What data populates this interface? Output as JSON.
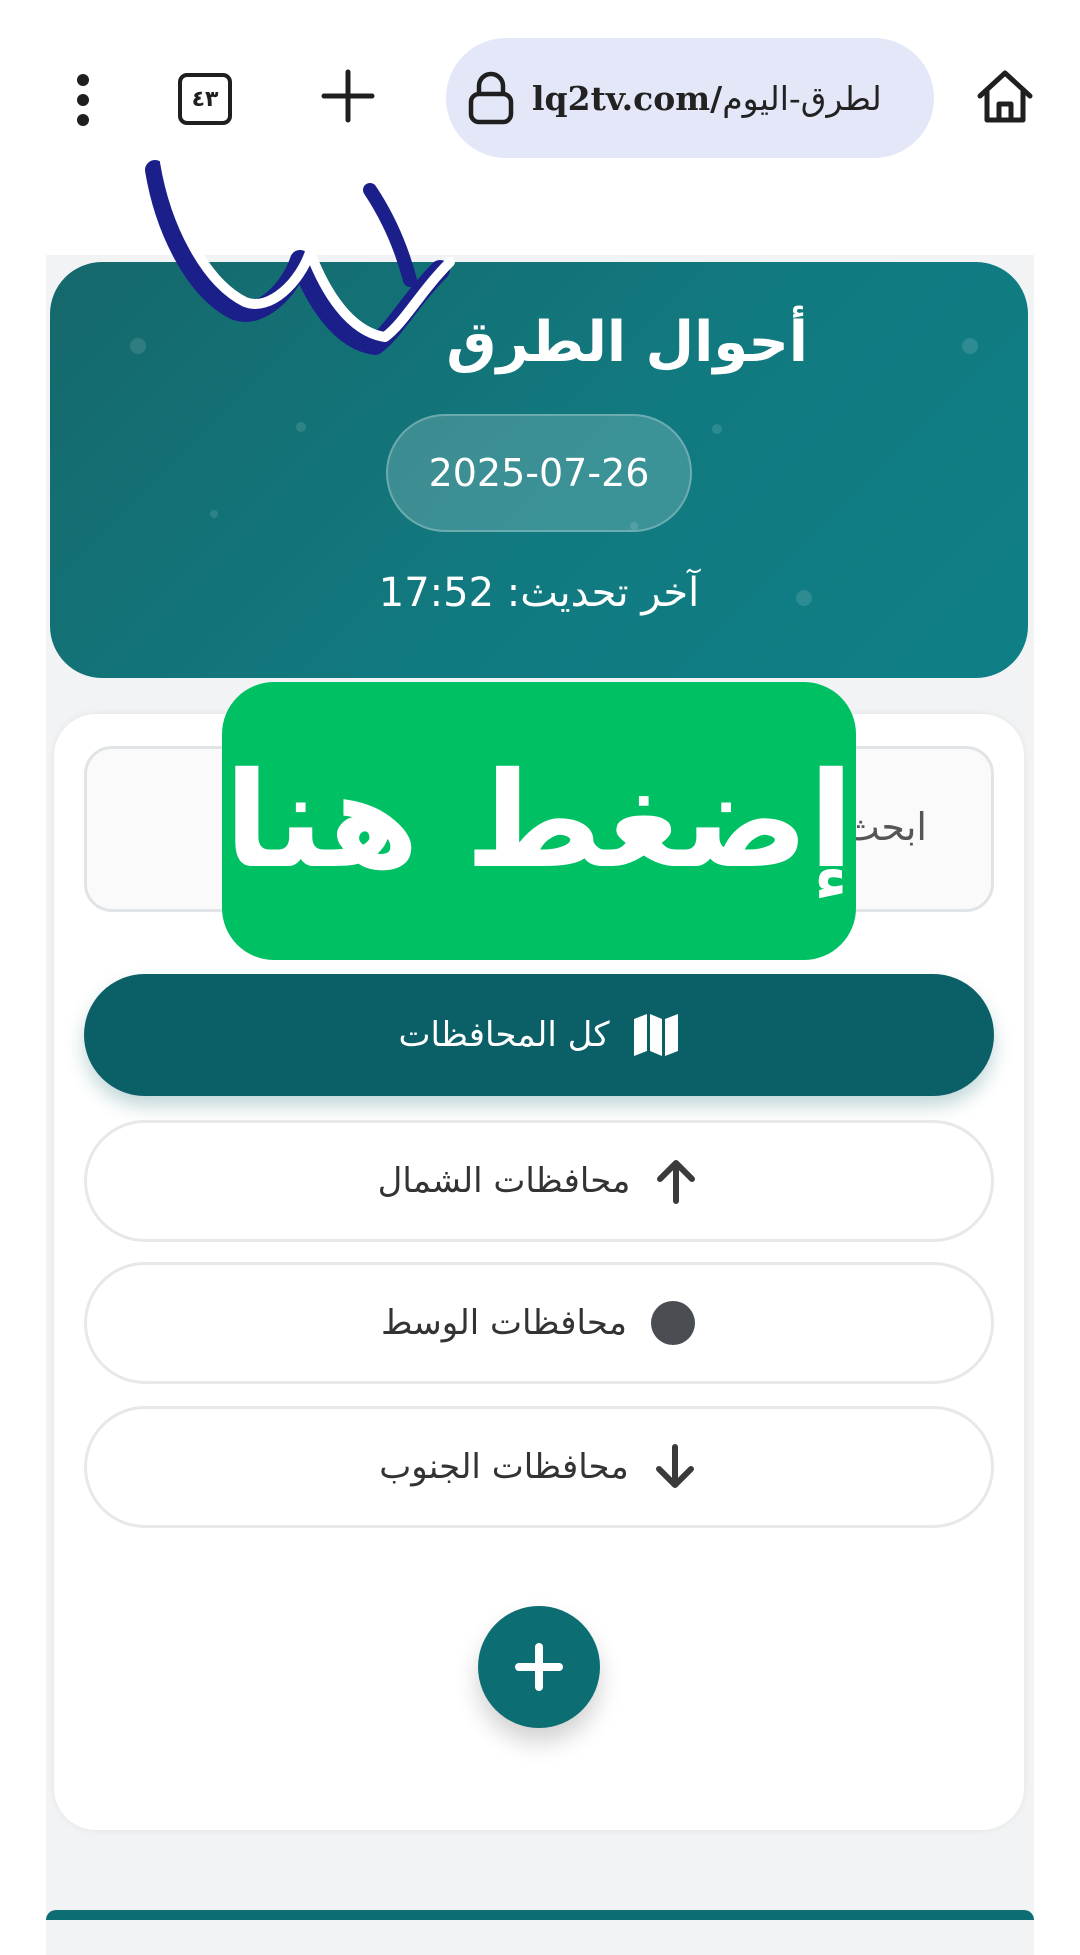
{
  "browser": {
    "tab_count": "٤٣",
    "url_domain": "lq2tv.com/",
    "url_path": "لطرق-اليوم"
  },
  "header": {
    "title": "أحوال الطرق",
    "date": "2025-07-26",
    "last_update": "آخر تحديث: 17:52"
  },
  "search": {
    "placeholder": "ابحث"
  },
  "regions": [
    {
      "label": "كل المحافظات",
      "icon": "map-icon",
      "active": true
    },
    {
      "label": "محافظات الشمال",
      "icon": "arrow-up-icon",
      "active": false
    },
    {
      "label": "محافظات الوسط",
      "icon": "circle-icon",
      "active": false
    },
    {
      "label": "محافظات الجنوب",
      "icon": "arrow-down-icon",
      "active": false
    }
  ],
  "overlay": {
    "promo_label": "إضغط هنا"
  },
  "colors": {
    "teal_dark": "#0b5f66",
    "teal": "#117a80",
    "promo_green": "#00c064",
    "address_bar": "#e3e7f7"
  }
}
